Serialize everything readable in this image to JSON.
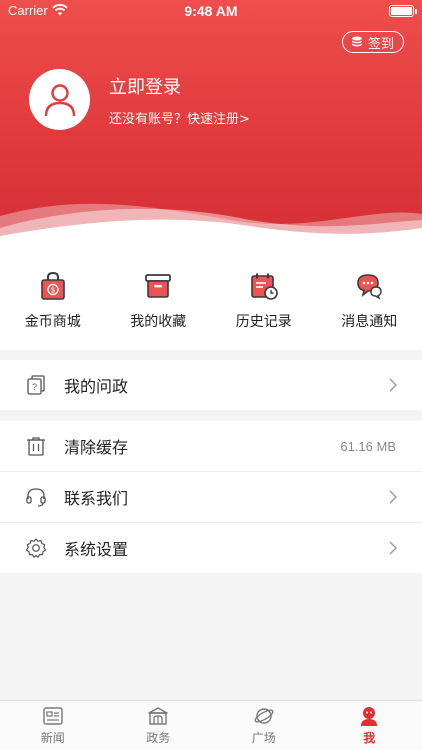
{
  "status_bar": {
    "carrier": "Carrier",
    "time": "9:48 AM"
  },
  "header": {
    "checkin_label": "签到",
    "login_title": "立即登录",
    "register_prompt": "还没有账号？快速注册>"
  },
  "quick_actions": [
    {
      "label": "金币商城",
      "icon": "coin-shop-icon"
    },
    {
      "label": "我的收藏",
      "icon": "favorites-box-icon"
    },
    {
      "label": "历史记录",
      "icon": "history-calendar-icon"
    },
    {
      "label": "消息通知",
      "icon": "message-bubble-icon"
    }
  ],
  "menu": {
    "my_questions": "我的问政",
    "clear_cache": "清除缓存",
    "cache_size": "61.16 MB",
    "contact_us": "联系我们",
    "settings": "系统设置"
  },
  "tabs": [
    {
      "label": "新闻",
      "icon": "news-icon"
    },
    {
      "label": "政务",
      "icon": "government-icon"
    },
    {
      "label": "广场",
      "icon": "planet-icon"
    },
    {
      "label": "我",
      "icon": "me-icon",
      "active": true
    }
  ],
  "colors": {
    "accent": "#e12e2e",
    "header_top": "#ee4e4c",
    "header_bottom": "#d32f36"
  }
}
